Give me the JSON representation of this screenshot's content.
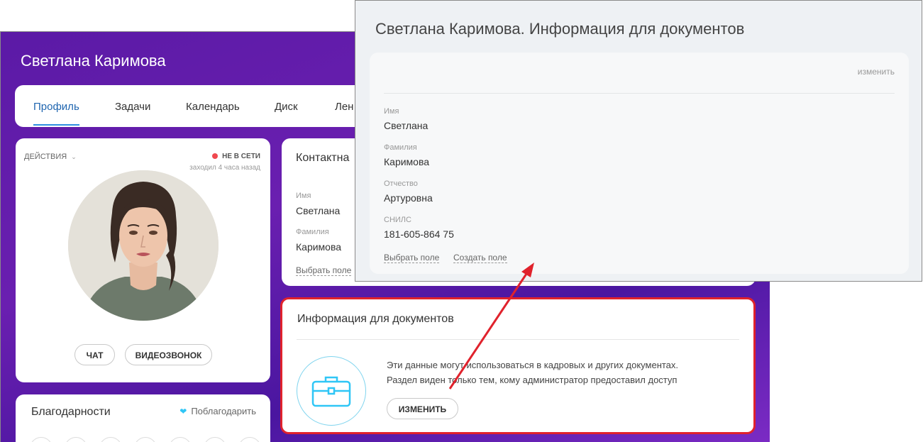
{
  "profile": {
    "name": "Светлана Каримова",
    "tabs": [
      "Профиль",
      "Задачи",
      "Календарь",
      "Диск",
      "Лен"
    ],
    "actions_label": "ДЕЙСТВИЯ",
    "status": "НЕ В СЕТИ",
    "last_seen": "заходил 4 часа назад",
    "chat_button": "ЧАТ",
    "video_button": "ВИДЕОЗВОНОК"
  },
  "thanks": {
    "title": "Благодарности",
    "link": "Поблагодарить"
  },
  "contacts": {
    "title": "Контактна",
    "first_name_label": "Имя",
    "first_name": "Светлана",
    "last_name_label": "Фамилия",
    "last_name": "Каримова",
    "select_field": "Выбрать поле"
  },
  "documents": {
    "title": "Информация для документов",
    "text_line1": "Эти данные могут использоваться в кадровых и других документах.",
    "text_line2": "Раздел виден только тем, кому администратор предоставил доступ",
    "change_button": "ИЗМЕНИТЬ"
  },
  "popup": {
    "title": "Светлана Каримова. Информация для документов",
    "edit": "изменить",
    "fields": [
      {
        "label": "Имя",
        "value": "Светлана"
      },
      {
        "label": "Фамилия",
        "value": "Каримова"
      },
      {
        "label": "Отчество",
        "value": "Артуровна"
      },
      {
        "label": "СНИЛС",
        "value": "181-605-864 75"
      }
    ],
    "select_field": "Выбрать поле",
    "create_field": "Создать поле"
  },
  "colors": {
    "accent_red": "#e0222c",
    "tab_active": "#2066b0",
    "status_offline": "#f0484f",
    "icon_blue": "#2fc6f6"
  }
}
